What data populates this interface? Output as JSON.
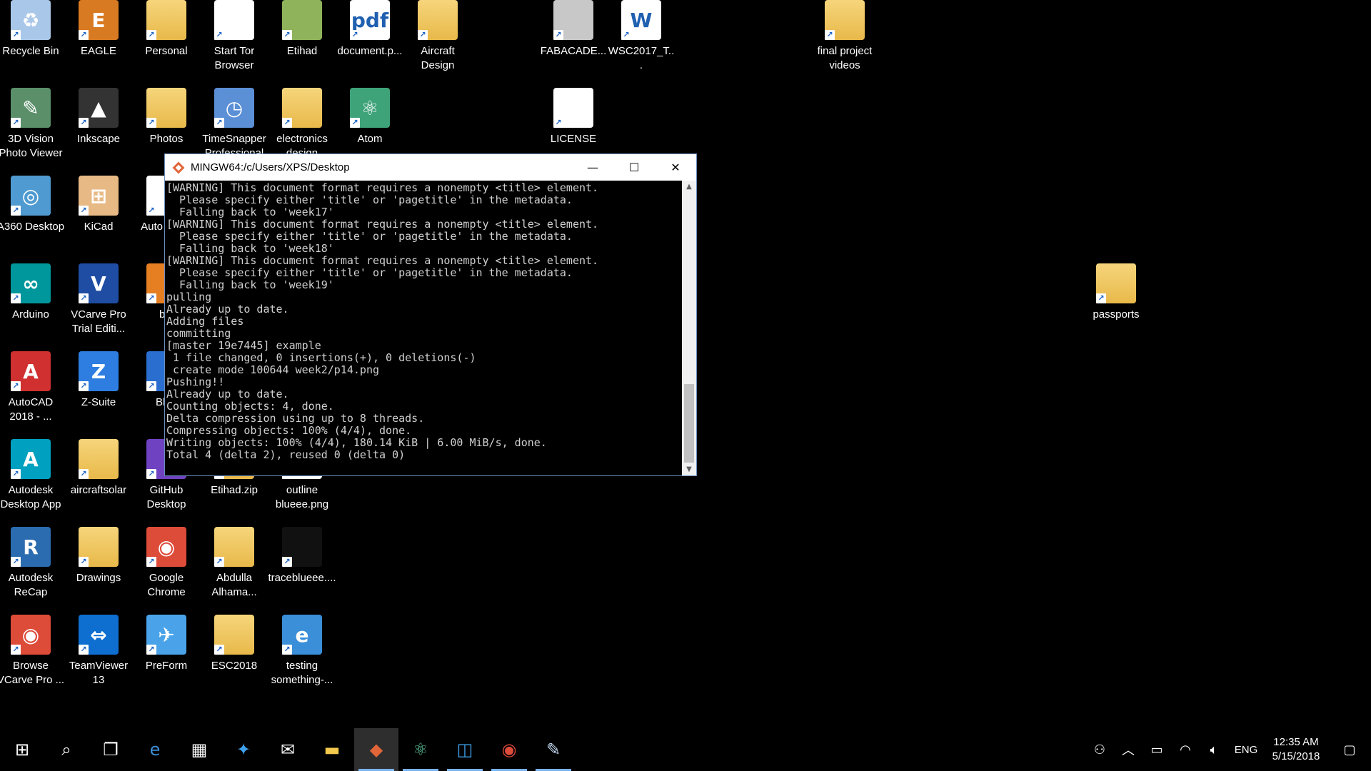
{
  "desktop_icons": [
    {
      "id": "recycle-bin",
      "label": "Recycle Bin",
      "glyph": "♻",
      "bg": "#a9c7e8"
    },
    {
      "id": "eagle",
      "label": "EAGLE",
      "glyph": "E",
      "bg": "#d87a22"
    },
    {
      "id": "personal",
      "label": "Personal",
      "glyph": "",
      "bg": "folder"
    },
    {
      "id": "start-tor",
      "label": "Start Tor Browser",
      "glyph": "",
      "bg": "#ffffff"
    },
    {
      "id": "etihad",
      "label": "Etihad",
      "glyph": "",
      "bg": "#8fb35a"
    },
    {
      "id": "document-pdf",
      "label": "document.p...",
      "glyph": "pdf",
      "bg": "#ffffff"
    },
    {
      "id": "aircraft-design",
      "label": "Aircraft Design",
      "glyph": "",
      "bg": "folder"
    },
    {
      "id": "fabacade",
      "label": "FABACADE...",
      "glyph": "",
      "bg": "#c8c8c8"
    },
    {
      "id": "wsc2017",
      "label": "WSC2017_T...",
      "glyph": "W",
      "bg": "#ffffff"
    },
    {
      "id": "final-project-videos",
      "label": "final project videos",
      "glyph": "",
      "bg": "folder"
    },
    {
      "id": "3d-vision",
      "label": "3D Vision Photo Viewer",
      "glyph": "✎",
      "bg": "#5a8f6a"
    },
    {
      "id": "inkscape",
      "label": "Inkscape",
      "glyph": "▲",
      "bg": "#333333"
    },
    {
      "id": "photos",
      "label": "Photos",
      "glyph": "",
      "bg": "folder"
    },
    {
      "id": "timesnapper",
      "label": "TimeSnapper Professional",
      "glyph": "◷",
      "bg": "#5b8fd6"
    },
    {
      "id": "electronics-design",
      "label": "electronics design",
      "glyph": "",
      "bg": "folder"
    },
    {
      "id": "atom",
      "label": "Atom",
      "glyph": "⚛",
      "bg": "#3fa37a"
    },
    {
      "id": "license",
      "label": "LICENSE",
      "glyph": "",
      "bg": "#ffffff"
    },
    {
      "id": "a360",
      "label": "A360 Desktop",
      "glyph": "◎",
      "bg": "#4f9bd1"
    },
    {
      "id": "kicad",
      "label": "KiCad",
      "glyph": "⊞",
      "bg": "#e7b985"
    },
    {
      "id": "auto-fusion",
      "label": "Auto Fusio",
      "glyph": "",
      "bg": "#ffffff"
    },
    {
      "id": "arduino",
      "label": "Arduino",
      "glyph": "∞",
      "bg": "#00979c"
    },
    {
      "id": "vcarve",
      "label": "VCarve Pro Trial Editi...",
      "glyph": "V",
      "bg": "#1f4da3"
    },
    {
      "id": "ble",
      "label": "ble",
      "glyph": "",
      "bg": "#e67f22"
    },
    {
      "id": "autocad",
      "label": "AutoCAD 2018 - ...",
      "glyph": "A",
      "bg": "#d03030"
    },
    {
      "id": "z-suite",
      "label": "Z-Suite",
      "glyph": "Z",
      "bg": "#2d7ee0"
    },
    {
      "id": "blue",
      "label": "Blue",
      "glyph": "",
      "bg": "#2a6fd0"
    },
    {
      "id": "autodesk-desktop",
      "label": "Autodesk Desktop App",
      "glyph": "A",
      "bg": "#00a0c0"
    },
    {
      "id": "aircraftsolar",
      "label": "aircraftsolar",
      "glyph": "",
      "bg": "folder"
    },
    {
      "id": "github-desktop",
      "label": "GitHub Desktop",
      "glyph": "",
      "bg": "#6f42c1"
    },
    {
      "id": "etihad-zip",
      "label": "Etihad.zip",
      "glyph": "",
      "bg": "folder"
    },
    {
      "id": "outline-blueee",
      "label": "outline blueee.png",
      "glyph": "",
      "bg": "#ffffff"
    },
    {
      "id": "autodesk-recap",
      "label": "Autodesk ReCap",
      "glyph": "R",
      "bg": "#2b6cb0"
    },
    {
      "id": "drawings",
      "label": "Drawings",
      "glyph": "",
      "bg": "folder"
    },
    {
      "id": "google-chrome",
      "label": "Google Chrome",
      "glyph": "◉",
      "bg": "#dd4b39"
    },
    {
      "id": "abdulla",
      "label": "Abdulla Alhama...",
      "glyph": "",
      "bg": "folder"
    },
    {
      "id": "traceblueee",
      "label": "traceblueee....",
      "glyph": "",
      "bg": "#111111"
    },
    {
      "id": "browse-vcarve",
      "label": "Browse VCarve Pro ...",
      "glyph": "◉",
      "bg": "#dd4b39"
    },
    {
      "id": "teamviewer",
      "label": "TeamViewer 13",
      "glyph": "⇔",
      "bg": "#0e6fd1"
    },
    {
      "id": "preform",
      "label": "PreForm",
      "glyph": "✈",
      "bg": "#4aa3e8"
    },
    {
      "id": "esc2018",
      "label": "ESC2018",
      "glyph": "",
      "bg": "folder"
    },
    {
      "id": "testing-something",
      "label": "testing something-...",
      "glyph": "e",
      "bg": "#3b8ed8"
    },
    {
      "id": "passports",
      "label": "passports",
      "glyph": "",
      "bg": "folder"
    }
  ],
  "terminal": {
    "title": "MINGW64:/c/Users/XPS/Desktop",
    "lines": [
      "[WARNING] This document format requires a nonempty <title> element.",
      "  Please specify either 'title' or 'pagetitle' in the metadata.",
      "  Falling back to 'week17'",
      "[WARNING] This document format requires a nonempty <title> element.",
      "  Please specify either 'title' or 'pagetitle' in the metadata.",
      "  Falling back to 'week18'",
      "[WARNING] This document format requires a nonempty <title> element.",
      "  Please specify either 'title' or 'pagetitle' in the metadata.",
      "  Falling back to 'week19'",
      "pulling",
      "Already up to date.",
      "Adding files",
      "committing",
      "[master 19e7445] example",
      " 1 file changed, 0 insertions(+), 0 deletions(-)",
      " create mode 100644 week2/p14.png",
      "Pushing!!",
      "Already up to date.",
      "Counting objects: 4, done.",
      "Delta compression using up to 8 threads.",
      "Compressing objects: 100% (4/4), done.",
      "Writing objects: 100% (4/4), 180.14 KiB | 6.00 MiB/s, done.",
      "Total 4 (delta 2), reused 0 (delta 0)"
    ],
    "minimize_icon": "minimize-icon",
    "maximize_icon": "maximize-icon",
    "close_icon": "close-icon"
  },
  "taskbar": {
    "items": [
      {
        "id": "start",
        "icon": "windows-icon",
        "glyph": "⊞",
        "color": "#ffffff"
      },
      {
        "id": "search",
        "icon": "search-icon",
        "glyph": "⌕",
        "color": "#ffffff"
      },
      {
        "id": "task-view",
        "icon": "task-view-icon",
        "glyph": "❐",
        "color": "#ffffff"
      },
      {
        "id": "edge",
        "icon": "edge-icon",
        "glyph": "e",
        "color": "#3b8ed8"
      },
      {
        "id": "store",
        "icon": "store-icon",
        "glyph": "▦",
        "color": "#ffffff"
      },
      {
        "id": "app-blue",
        "icon": "compass-icon",
        "glyph": "✦",
        "color": "#3fa0e8"
      },
      {
        "id": "mail",
        "icon": "mail-icon",
        "glyph": "✉",
        "color": "#ffffff"
      },
      {
        "id": "explorer",
        "icon": "folder-icon",
        "glyph": "▬",
        "color": "#f2c94c"
      },
      {
        "id": "git-bash",
        "icon": "git-icon",
        "glyph": "◆",
        "color": "#e0663a",
        "active": true
      },
      {
        "id": "atom-tb",
        "icon": "atom-icon",
        "glyph": "⚛",
        "color": "#5fc59a",
        "run": true
      },
      {
        "id": "app-frame",
        "icon": "frame-icon",
        "glyph": "◫",
        "color": "#3fa0e8",
        "run": true
      },
      {
        "id": "chrome-tb",
        "icon": "chrome-icon",
        "glyph": "◉",
        "color": "#dd4b39",
        "run": true
      },
      {
        "id": "paint",
        "icon": "paint-icon",
        "glyph": "✎",
        "color": "#c0d8f0",
        "run": true
      }
    ],
    "tray": {
      "people_icon": "people-icon",
      "chevron_icon": "chevron-up-icon",
      "battery_icon": "battery-icon",
      "wifi_icon": "wifi-icon",
      "volume_icon": "volume-icon",
      "language": "ENG",
      "time": "12:35 AM",
      "date": "5/15/2018",
      "notification_icon": "notification-icon"
    }
  }
}
